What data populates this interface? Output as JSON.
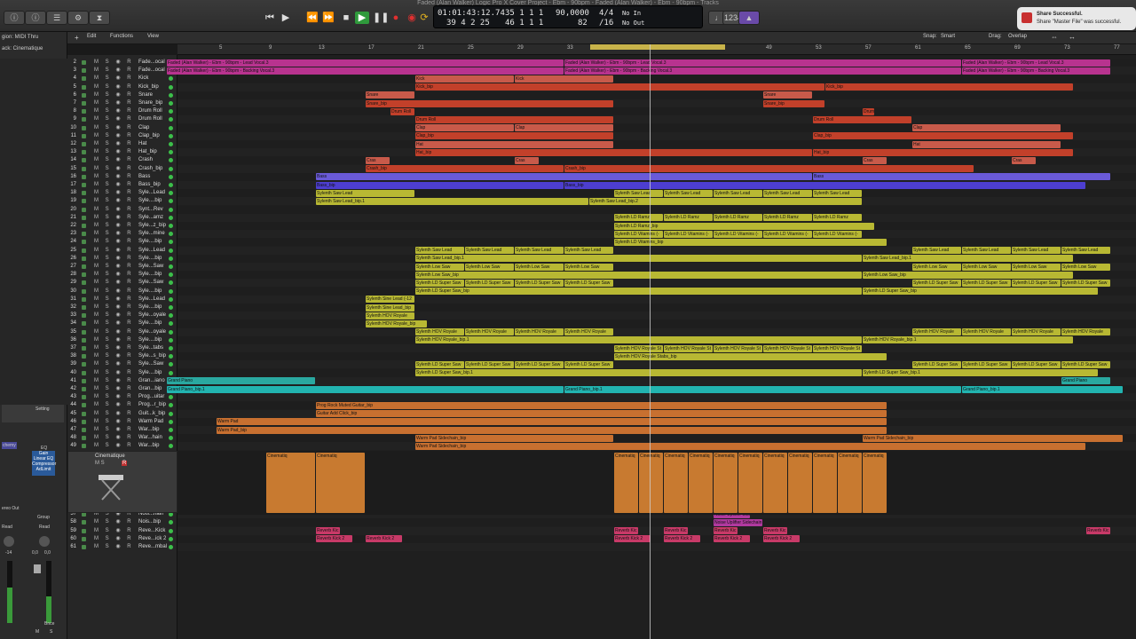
{
  "window_title": "Faded (Alan Walker) Logic Pro X Cover Project - Ebm - 90bpm - Faded (Alan Walker) - Ebm - 90bpm - Tracks",
  "lcd": {
    "time": "01:01:43:12.74",
    "bars": "39 4 2 25",
    "pos_top": "35  1  1     1",
    "pos_bottom": "46  1  1     1",
    "tempo_top": "90,0000",
    "tempo_bottom": "82",
    "sig_top": "4/4",
    "sig_bottom": "/16",
    "in": "No In",
    "out": "No Out"
  },
  "notification": {
    "title": "Share Successful.",
    "body": "Share \"Master File\" was successful."
  },
  "inspector": {
    "midi_thru": "gion: MIDI Thru",
    "cinematique": "ack: Cinematique",
    "setting": "Setting",
    "eq": "EQ",
    "chemy": "chemy",
    "gain": "Gain",
    "linear_eq": "Linear EQ",
    "compressor": "Compressor",
    "adlimit": "AdLimit",
    "ereo_out": "ereo Out",
    "group": "Group",
    "read": "Read",
    "read2": "Read",
    "val1": "0,0",
    "val2": "0,0",
    "val3": "-14",
    "bnce": "Bnce",
    "m": "M",
    "s": "S"
  },
  "edit_bar": {
    "edit": "Edit",
    "functions": "Functions",
    "view": "View",
    "snap_label": "Snap:",
    "snap": "Smart",
    "drag_label": "Drag:",
    "drag": "Overlap"
  },
  "ruler": [
    "5",
    "9",
    "13",
    "17",
    "21",
    "25",
    "29",
    "33",
    "37",
    "41",
    "45",
    "49",
    "53",
    "57",
    "61",
    "65",
    "69",
    "73",
    "77"
  ],
  "instrument_panel": {
    "name": "Cinematique"
  },
  "tracks": [
    {
      "n": "2",
      "name": "Fade...ocal",
      "color": "#c0389c"
    },
    {
      "n": "3",
      "name": "Fade...ocal",
      "color": "#c0389c"
    },
    {
      "n": "4",
      "name": "Kick",
      "color": "#d0402a"
    },
    {
      "n": "5",
      "name": "Kick_bip",
      "color": "#d0402a"
    },
    {
      "n": "6",
      "name": "Snare",
      "color": "#d0402a"
    },
    {
      "n": "7",
      "name": "Snare_bip",
      "color": "#d0402a"
    },
    {
      "n": "8",
      "name": "Drum Roll",
      "color": "#d0402a"
    },
    {
      "n": "9",
      "name": "Drum Roll",
      "color": "#d0402a"
    },
    {
      "n": "10",
      "name": "Clap",
      "color": "#d0402a"
    },
    {
      "n": "11",
      "name": "Clap_bip",
      "color": "#d0402a"
    },
    {
      "n": "12",
      "name": "Hat",
      "color": "#d0402a"
    },
    {
      "n": "13",
      "name": "Hat_bip",
      "color": "#d0402a"
    },
    {
      "n": "14",
      "name": "Crash",
      "color": "#d0402a"
    },
    {
      "n": "15",
      "name": "Crash_bip",
      "color": "#d0402a"
    },
    {
      "n": "16",
      "name": "Bass",
      "color": "#5a4ad8"
    },
    {
      "n": "17",
      "name": "Bass_bip",
      "color": "#5a4ad8"
    },
    {
      "n": "18",
      "name": "Syle...Lead",
      "color": "#c4c43a"
    },
    {
      "n": "19",
      "name": "Syle....bip",
      "color": "#c4c43a"
    },
    {
      "n": "20",
      "name": "Synt...Rev",
      "color": "#c4c43a"
    },
    {
      "n": "21",
      "name": "Syle...amz",
      "color": "#c4c43a"
    },
    {
      "n": "22",
      "name": "Syle...z_bip",
      "color": "#c4c43a"
    },
    {
      "n": "23",
      "name": "Syle...mine",
      "color": "#c4c43a"
    },
    {
      "n": "24",
      "name": "Syle....bip",
      "color": "#c4c43a"
    },
    {
      "n": "25",
      "name": "Syle...Lead",
      "color": "#c4c43a"
    },
    {
      "n": "26",
      "name": "Syle....bip",
      "color": "#c4c43a"
    },
    {
      "n": "27",
      "name": "Syle...Saw",
      "color": "#c4c43a"
    },
    {
      "n": "28",
      "name": "Syle....bip",
      "color": "#c4c43a"
    },
    {
      "n": "29",
      "name": "Syle...Saw",
      "color": "#c4c43a"
    },
    {
      "n": "30",
      "name": "Syle....bip",
      "color": "#c4c43a"
    },
    {
      "n": "31",
      "name": "Syle...Lead",
      "color": "#c4c43a"
    },
    {
      "n": "32",
      "name": "Syle....bip",
      "color": "#c4c43a"
    },
    {
      "n": "33",
      "name": "Syle...oyale",
      "color": "#c4c43a"
    },
    {
      "n": "34",
      "name": "Syle....bip",
      "color": "#c4c43a"
    },
    {
      "n": "35",
      "name": "Syle...oyale",
      "color": "#c4c43a"
    },
    {
      "n": "36",
      "name": "Syle....bip",
      "color": "#c4c43a"
    },
    {
      "n": "37",
      "name": "Syle...tabs",
      "color": "#c4c43a"
    },
    {
      "n": "38",
      "name": "Syle...s_bip",
      "color": "#c4c43a"
    },
    {
      "n": "39",
      "name": "Syle...Saw",
      "color": "#c4c43a"
    },
    {
      "n": "40",
      "name": "Syle....bip",
      "color": "#c4c43a"
    },
    {
      "n": "41",
      "name": "Gran...iano",
      "color": "#2ab0a8"
    },
    {
      "n": "42",
      "name": "Gran...bip",
      "color": "#2ab0a8"
    },
    {
      "n": "43",
      "name": "Prog...uitar",
      "color": "#c87030"
    },
    {
      "n": "44",
      "name": "Prog...r_bip",
      "color": "#c87030"
    },
    {
      "n": "45",
      "name": "Guit...k_bip",
      "color": "#c87030"
    },
    {
      "n": "46",
      "name": "Warm Pad",
      "color": "#c87030"
    },
    {
      "n": "47",
      "name": "War...bip",
      "color": "#c87030"
    },
    {
      "n": "48",
      "name": "War...hain",
      "color": "#c87030"
    },
    {
      "n": "49",
      "name": "War...bip",
      "color": "#c87030"
    },
    {
      "n": "50",
      "name": "",
      "color": "#c87030"
    },
    {
      "n": "51",
      "name": "Noise Riser",
      "color": "#c03ab0"
    },
    {
      "n": "52",
      "name": "Nois...r_bip",
      "color": "#c03ab0"
    },
    {
      "n": "53",
      "name": "Nois...shift",
      "color": "#c03ab0"
    },
    {
      "n": "54",
      "name": "Nois...t_bip",
      "color": "#c03ab0"
    },
    {
      "n": "55",
      "name": "Nois...hain",
      "color": "#c03ab0"
    },
    {
      "n": "56",
      "name": "Nois...bip",
      "color": "#c03ab0"
    },
    {
      "n": "57",
      "name": "Nois...hain",
      "color": "#c03ab0"
    },
    {
      "n": "58",
      "name": "Nois...bip",
      "color": "#c03ab0"
    },
    {
      "n": "59",
      "name": "Reve...Kick",
      "color": "#d03a6a"
    },
    {
      "n": "60",
      "name": "Reve...ick 2",
      "color": "#d03a6a"
    },
    {
      "n": "61",
      "name": "Reve...mbal",
      "color": "#d03a6a"
    }
  ],
  "regions": [
    {
      "label": "Faded (Alan Walker) - Ebm - 90bpm - Lead Vocal.3",
      "color": "#b8338f"
    },
    {
      "label": "Faded (Alan Walker) - Ebm - 90bpm - Backing Vocal.3",
      "color": "#b8338f"
    },
    {
      "label": "Faded (Alan Walker) - Ebm - 90bpm - Lead Vocal.3",
      "color": "#b8338f"
    },
    {
      "label": "Faded (Alan Walker) - Ebm - 90bpm - Backing Vocal.3",
      "color": "#b8338f"
    },
    {
      "label": "Faded (Alan Walker) - Ebm - 90bpm - Lead Vocal.3",
      "color": "#b8338f"
    },
    {
      "label": "Faded (Alan Walker) - Ebm - 90bpm - Backing Vocal.3",
      "color": "#b8338f"
    },
    {
      "label": "Kick",
      "color": "#c85a4a"
    },
    {
      "label": "Kick_bip",
      "color": "#c2402a"
    },
    {
      "label": "Kick_bip",
      "color": "#c2402a"
    },
    {
      "label": "Snare",
      "color": "#c85a4a"
    },
    {
      "label": "Snare_bip",
      "color": "#c2402a"
    },
    {
      "label": "Snare_bip",
      "color": "#c2402a"
    },
    {
      "label": "Drum Roll",
      "color": "#c2402a"
    },
    {
      "label": "Drum Roll",
      "color": "#c2402a"
    },
    {
      "label": "Clap",
      "color": "#c85a4a"
    },
    {
      "label": "Clap_bip",
      "color": "#c2402a"
    },
    {
      "label": "Clap_bip",
      "color": "#c2402a"
    },
    {
      "label": "Hat",
      "color": "#c85a4a"
    },
    {
      "label": "Hat_bip",
      "color": "#c2402a"
    },
    {
      "label": "Hat_bip",
      "color": "#c2402a"
    },
    {
      "label": "Cras",
      "color": "#c85a4a"
    },
    {
      "label": "Crash_bip",
      "color": "#c2402a"
    },
    {
      "label": "Crash_bip",
      "color": "#c2402a"
    },
    {
      "label": "Bass",
      "color": "#6a5ad8"
    },
    {
      "label": "Bass_bip",
      "color": "#4d3ed0"
    },
    {
      "label": "Bass_bip",
      "color": "#4d3ed0"
    },
    {
      "label": "Sylenth Saw Lead",
      "color": "#b8b833"
    },
    {
      "label": "Sylenth Saw Lead_bip.1",
      "color": "#b8b833"
    },
    {
      "label": "Sylenth Saw Lead_bip.2",
      "color": "#b8b833"
    },
    {
      "label": "Sylenth LD Ramz",
      "color": "#b8b833"
    },
    {
      "label": "Sylenth LD Ramz_bip",
      "color": "#b8b833"
    },
    {
      "label": "Sylenth LD Vitamins (-",
      "color": "#b8b833"
    },
    {
      "label": "Sylenth LD Vitamins_bip",
      "color": "#b8b833"
    },
    {
      "label": "Sylenth Saw Lead",
      "color": "#b8b833"
    },
    {
      "label": "Sylenth Saw Lead_bip.1",
      "color": "#b8b833"
    },
    {
      "label": "Sylenth Low Saw",
      "color": "#b8b833"
    },
    {
      "label": "Sylenth Low Saw_bip",
      "color": "#b8b833"
    },
    {
      "label": "Sylenth LD Super Saw",
      "color": "#b8b833"
    },
    {
      "label": "Sylenth LD Super Saw_bip",
      "color": "#b8b833"
    },
    {
      "label": "Sylenth Sine Lead (-12",
      "color": "#b8b833"
    },
    {
      "label": "Sylenth Sine Lead_bip",
      "color": "#b8b833"
    },
    {
      "label": "Sylenth HOV Royale",
      "color": "#b8b833"
    },
    {
      "label": "Sylenth HOV Royale_bip",
      "color": "#b8b833"
    },
    {
      "label": "Sylenth HOV Royale",
      "color": "#b8b833"
    },
    {
      "label": "Sylenth HOV Royale_bip.1",
      "color": "#b8b833"
    },
    {
      "label": "Sylenth HOV Royale St",
      "color": "#b8b833"
    },
    {
      "label": "Sylenth HOV Royale Stabs_bip",
      "color": "#b8b833"
    },
    {
      "label": "Sylenth LD Super Saw",
      "color": "#b8b833"
    },
    {
      "label": "Sylenth LD Super Saw_bip.1",
      "color": "#b8b833"
    },
    {
      "label": "Grand Piano",
      "color": "#2aa8a0"
    },
    {
      "label": "Grand Piano_bip.1",
      "color": "#22b4b0"
    },
    {
      "label": "Grand Piano_bip.1",
      "color": "#22b4b0"
    },
    {
      "label": "Prog Rock Muted Guitar_bip",
      "color": "#c87030"
    },
    {
      "label": "Guitar Add Click_bip",
      "color": "#c87030"
    },
    {
      "label": "Warm Pad",
      "color": "#c87030"
    },
    {
      "label": "Warm Pad_bip",
      "color": "#c87030"
    },
    {
      "label": "Warm Pad Sidechain_bip",
      "color": "#c87030"
    },
    {
      "label": "Cinematiq",
      "color": "#c87a30"
    },
    {
      "label": "Noise Riser",
      "color": "#b0399f"
    },
    {
      "label": "Noise Riser_bip",
      "color": "#b0399f"
    },
    {
      "label": "Noise Downshift",
      "color": "#b0399f"
    },
    {
      "label": "Noise Downshift_bip",
      "color": "#b0399f"
    },
    {
      "label": "noise/rev drop",
      "color": "#b0399f"
    },
    {
      "label": "noise/rev drop_bip",
      "color": "#b0399f"
    },
    {
      "label": "Noise Uplifter Sidechain",
      "color": "#b0399f"
    },
    {
      "label": "Reverb Kic",
      "color": "#c83a68"
    },
    {
      "label": "Reverb Kick 2",
      "color": "#c83a68"
    }
  ]
}
